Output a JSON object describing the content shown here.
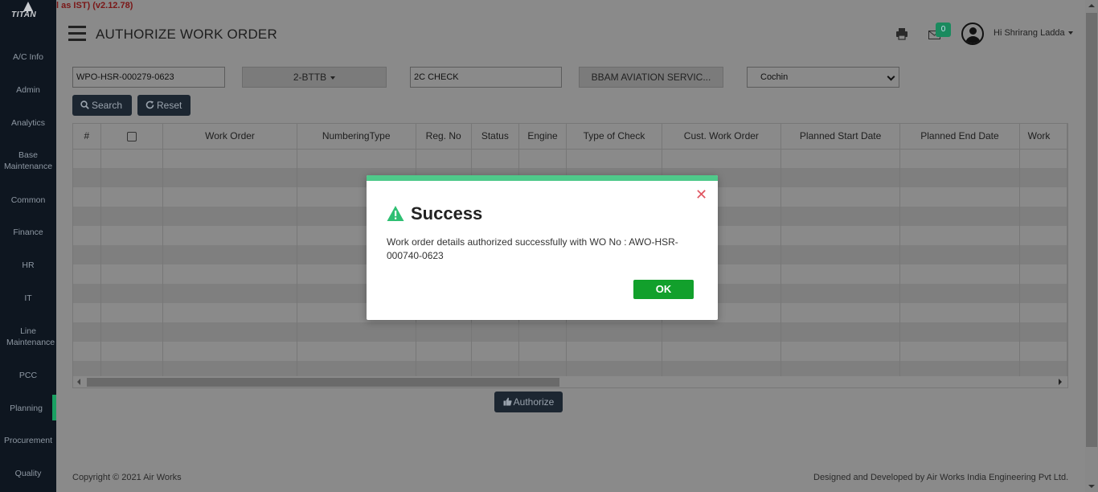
{
  "app": {
    "logo_text": "TITAN",
    "version_text": "l as IST) (v2.12.78)"
  },
  "sidebar": {
    "items": [
      {
        "label": "A/C Info"
      },
      {
        "label": "Admin"
      },
      {
        "label": "Analytics"
      },
      {
        "label": "Base Maintenance"
      },
      {
        "label": "Common"
      },
      {
        "label": "Finance"
      },
      {
        "label": "HR"
      },
      {
        "label": "IT"
      },
      {
        "label": "Line Maintenance"
      },
      {
        "label": "PCC"
      },
      {
        "label": "Planning"
      },
      {
        "label": "Procurement"
      },
      {
        "label": "Quality"
      }
    ],
    "active_item": "Planning"
  },
  "header": {
    "title": "AUTHORIZE WORK ORDER",
    "notification_count": "0",
    "user_greeting": "Hi Shrirang Ladda",
    "print_icon": "print-icon",
    "mail_icon": "envelope-icon",
    "avatar_icon": "user-circle-icon"
  },
  "filters": {
    "work_order_value": "WPO-HSR-000279-0623",
    "registration_value": "2-BTTB",
    "check_value": "2C CHECK",
    "customer_value": "BBAM AVIATION SERVIC...",
    "station_value": "Cochin"
  },
  "actions": {
    "search_label": "Search",
    "reset_label": "Reset",
    "authorize_label": "Authorize"
  },
  "table": {
    "columns": [
      "#",
      "",
      "Work Order",
      "NumberingType",
      "Reg. No",
      "Status",
      "Engine",
      "Type of Check",
      "Cust. Work Order",
      "Planned Start Date",
      "Planned End Date",
      "Work"
    ],
    "rows": []
  },
  "footer": {
    "copyright": "Copyright © 2021 Air Works",
    "credit": "Designed and Developed by Air Works India Engineering Pvt Ltd."
  },
  "modal": {
    "title": "Success",
    "message": "Work order details authorized successfully with WO No : AWO-HSR-000740-0623",
    "ok_label": "OK",
    "icon": "warning-triangle-icon",
    "close_icon": "close-icon"
  },
  "colors": {
    "success_bar": "#4fc98a",
    "ok_button": "#12a02c",
    "close_x": "#e05561",
    "badge": "#1a8a5e",
    "sidebar_bg": "#0e1620",
    "active_indicator": "#1aa062"
  }
}
